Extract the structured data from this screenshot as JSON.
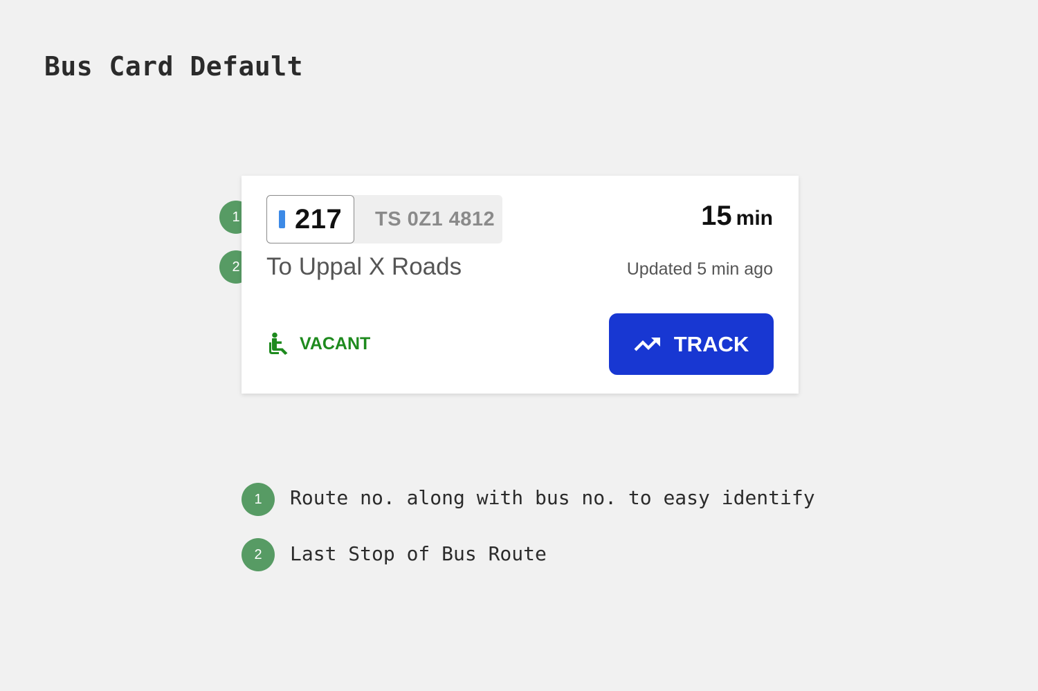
{
  "page": {
    "title": "Bus Card Default"
  },
  "card": {
    "route_number": "217",
    "bus_number": "TS 0Z1 4812",
    "eta_value": "15",
    "eta_unit": "min",
    "destination": "To Uppal X Roads",
    "updated": "Updated 5 min ago",
    "vacancy_label": "VACANT",
    "vacancy_icon": "seat-icon",
    "track_label": "TRACK",
    "track_icon": "trending-up-icon"
  },
  "markers": [
    "1",
    "2"
  ],
  "legend": [
    {
      "number": "1",
      "text": "Route no. along with bus no. to easy identify"
    },
    {
      "number": "2",
      "text": "Last Stop of Bus Route"
    }
  ],
  "colors": {
    "background": "#f1f1f1",
    "marker": "#579b64",
    "route_accent": "#3d8ae6",
    "vacant": "#1e8a1e",
    "track_button": "#1837d2"
  }
}
